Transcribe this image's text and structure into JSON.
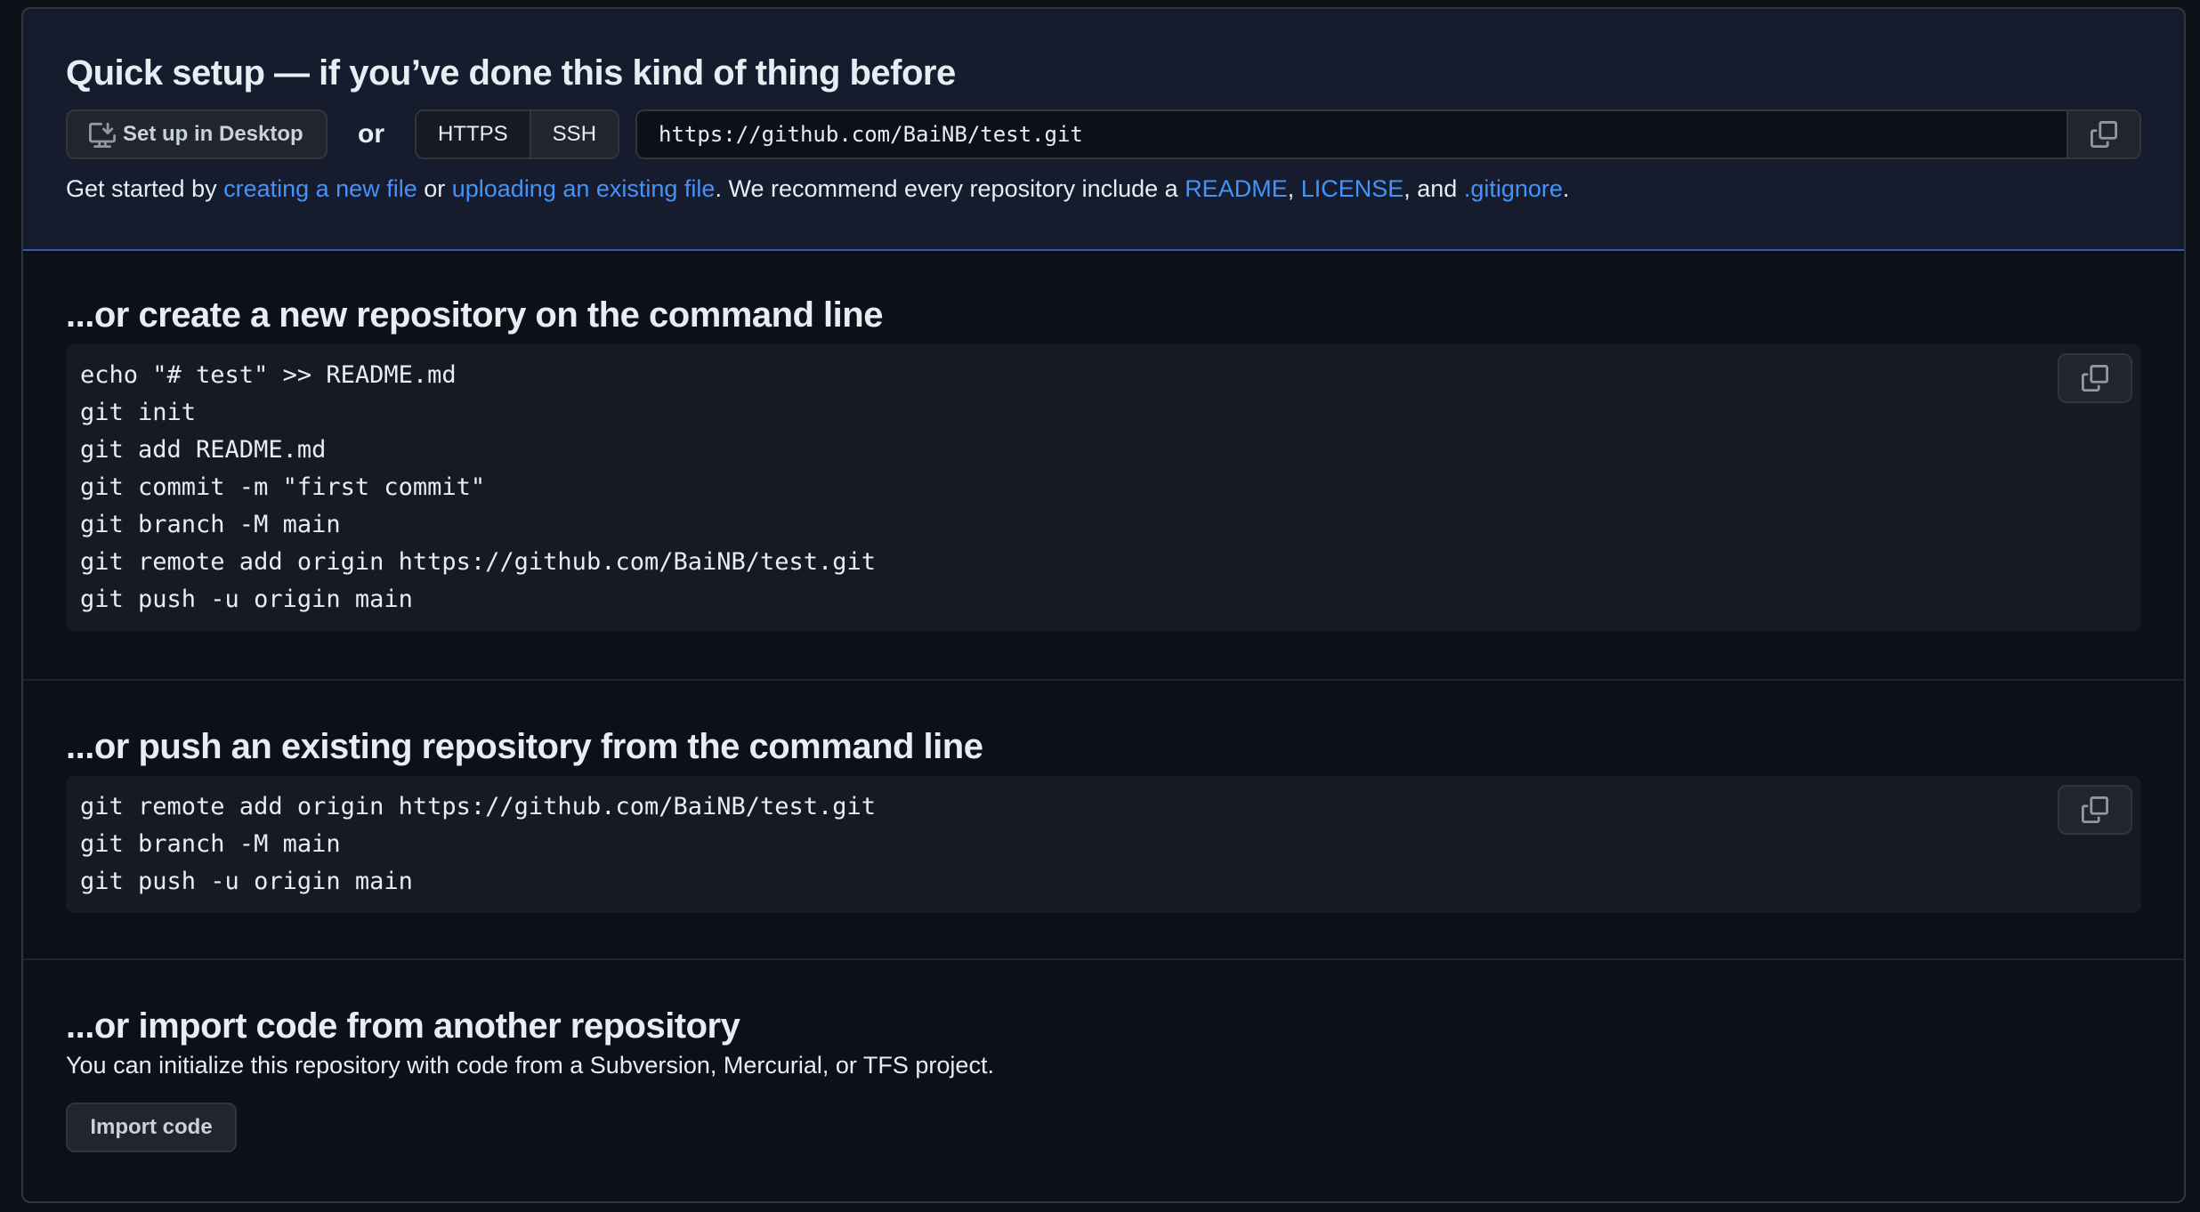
{
  "quick_setup": {
    "title": "Quick setup — if you’ve done this kind of thing before",
    "desktop_button": "Set up in Desktop",
    "or_text": "or",
    "protocols": [
      "HTTPS",
      "SSH"
    ],
    "selected_protocol": "SSH",
    "clone_url": "https://github.com/BaiNB/test.git",
    "hint": {
      "prefix": "Get started by ",
      "link_new_file": "creating a new file",
      "mid1": " or ",
      "link_upload": "uploading an existing file",
      "mid2": ". We recommend every repository include a ",
      "link_readme": "README",
      "sep1": ", ",
      "link_license": "LICENSE",
      "sep2": ", and ",
      "link_gitignore": ".gitignore",
      "suffix": "."
    }
  },
  "create_new": {
    "title": "...or create a new repository on the command line",
    "lines": [
      "echo \"# test\" >> README.md",
      "git init",
      "git add README.md",
      "git commit -m \"first commit\"",
      "git branch -M main",
      "git remote add origin https://github.com/BaiNB/test.git",
      "git push -u origin main"
    ]
  },
  "push_existing": {
    "title": "...or push an existing repository from the command line",
    "lines": [
      "git remote add origin https://github.com/BaiNB/test.git",
      "git branch -M main",
      "git push -u origin main"
    ]
  },
  "import_code": {
    "title": "...or import code from another repository",
    "description": "You can initialize this repository with code from a Subversion, Mercurial, or TFS project.",
    "button": "Import code"
  },
  "icons": {
    "desktop": "desktop-download-icon",
    "copy": "copy-icon"
  },
  "colors": {
    "background": "#0d1117",
    "quick_setup_bg": "#161b2e",
    "link": "#4493f8",
    "border": "#30363d"
  }
}
